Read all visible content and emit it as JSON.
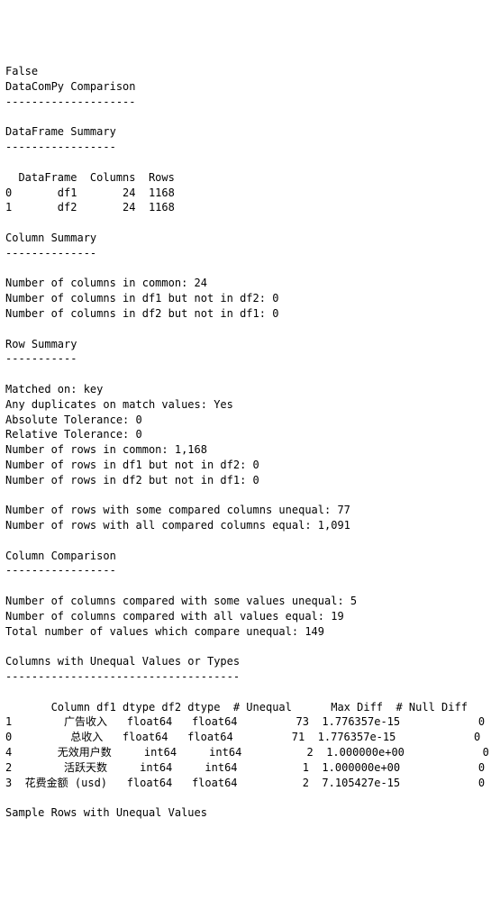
{
  "lines": [
    "False",
    "DataComPy Comparison",
    "--------------------",
    "",
    "DataFrame Summary",
    "-----------------",
    "",
    "  DataFrame  Columns  Rows",
    "0       df1       24  1168",
    "1       df2       24  1168",
    "",
    "Column Summary",
    "--------------",
    "",
    "Number of columns in common: 24",
    "Number of columns in df1 but not in df2: 0",
    "Number of columns in df2 but not in df1: 0",
    "",
    "Row Summary",
    "-----------",
    "",
    "Matched on: key",
    "Any duplicates on match values: Yes",
    "Absolute Tolerance: 0",
    "Relative Tolerance: 0",
    "Number of rows in common: 1,168",
    "Number of rows in df1 but not in df2: 0",
    "Number of rows in df2 but not in df1: 0",
    "",
    "Number of rows with some compared columns unequal: 77",
    "Number of rows with all compared columns equal: 1,091",
    "",
    "Column Comparison",
    "-----------------",
    "",
    "Number of columns compared with some values unequal: 5",
    "Number of columns compared with all values equal: 19",
    "Total number of values which compare unequal: 149",
    "",
    "Columns with Unequal Values or Types",
    "------------------------------------",
    "",
    "       Column df1 dtype df2 dtype  # Unequal      Max Diff  # Null Diff",
    "1        广告收入   float64   float64         73  1.776357e-15            0",
    "0         总收入   float64   float64         71  1.776357e-15            0",
    "4       无效用户数     int64     int64          2  1.000000e+00            0",
    "2        活跃天数     int64     int64          1  1.000000e+00            0",
    "3  花费金额 (usd)   float64   float64          2  7.105427e-15            0",
    "",
    "Sample Rows with Unequal Values"
  ]
}
